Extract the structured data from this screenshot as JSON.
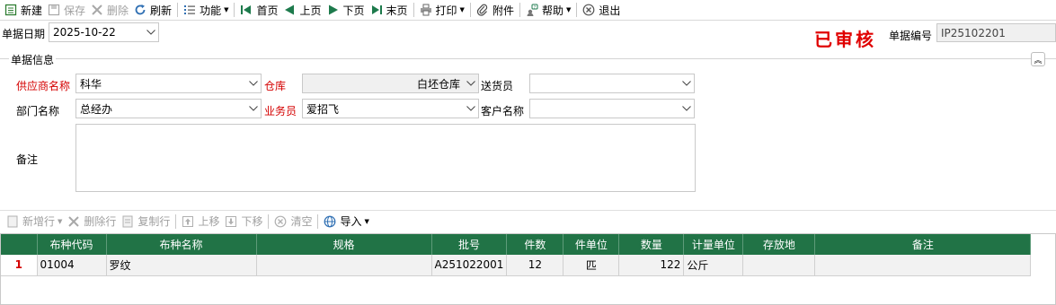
{
  "toolbar": {
    "new": "新建",
    "save": "保存",
    "delete": "删除",
    "refresh": "刷新",
    "function": "功能",
    "first": "首页",
    "prev": "上页",
    "next": "下页",
    "last": "末页",
    "print": "打印",
    "attach": "附件",
    "help": "帮助",
    "exit": "退出"
  },
  "header": {
    "date_label": "单据日期",
    "date_value": "2025-10-22",
    "stamp": "已审核",
    "number_label": "单据编号",
    "number_value": "IP25102201"
  },
  "group": {
    "title": "单据信息",
    "supplier_label": "供应商名称",
    "supplier_value": "科华",
    "warehouse_label": "仓库",
    "warehouse_value": "白坯仓库",
    "deliverer_label": "送货员",
    "deliverer_value": "",
    "dept_label": "部门名称",
    "dept_value": "总经办",
    "salesman_label": "业务员",
    "salesman_value": "爱招飞",
    "customer_label": "客户名称",
    "customer_value": "",
    "memo_label": "备注"
  },
  "grid_toolbar": {
    "add_row": "新增行",
    "del_row": "删除行",
    "copy_row": "复制行",
    "move_up": "上移",
    "move_down": "下移",
    "clear": "清空",
    "import": "导入"
  },
  "table": {
    "columns": [
      "布种代码",
      "布种名称",
      "规格",
      "批号",
      "件数",
      "件单位",
      "数量",
      "计量单位",
      "存放地",
      "备注"
    ],
    "rows": [
      {
        "index": "1",
        "code": "01004",
        "name": "罗纹",
        "spec": "",
        "batch": "A251022001",
        "pieces": "12",
        "piece_unit": "匹",
        "qty": "122",
        "unit": "公斤",
        "location": "",
        "remark": ""
      }
    ]
  },
  "colors": {
    "grid_header": "#217346",
    "required_label": "#d40000",
    "stamp": "#e00000"
  }
}
